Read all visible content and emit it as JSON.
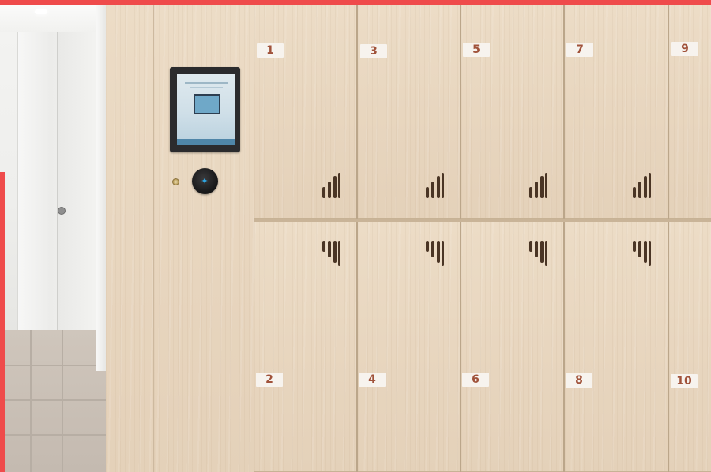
{
  "colors": {
    "accent": "#ef4b4b",
    "label_text": "#a0523a",
    "reader_light": "#2ea8e6"
  },
  "icons": {
    "nfc": "nfc-icon",
    "vent": "ventilation-slots-icon"
  },
  "lockers": {
    "top_row": [
      {
        "label": "1"
      },
      {
        "label": "3"
      },
      {
        "label": "5"
      },
      {
        "label": "7"
      },
      {
        "label": "9"
      }
    ],
    "bottom_row": [
      {
        "label": "2"
      },
      {
        "label": "4"
      },
      {
        "label": "6"
      },
      {
        "label": "8"
      },
      {
        "label": "10"
      }
    ]
  }
}
